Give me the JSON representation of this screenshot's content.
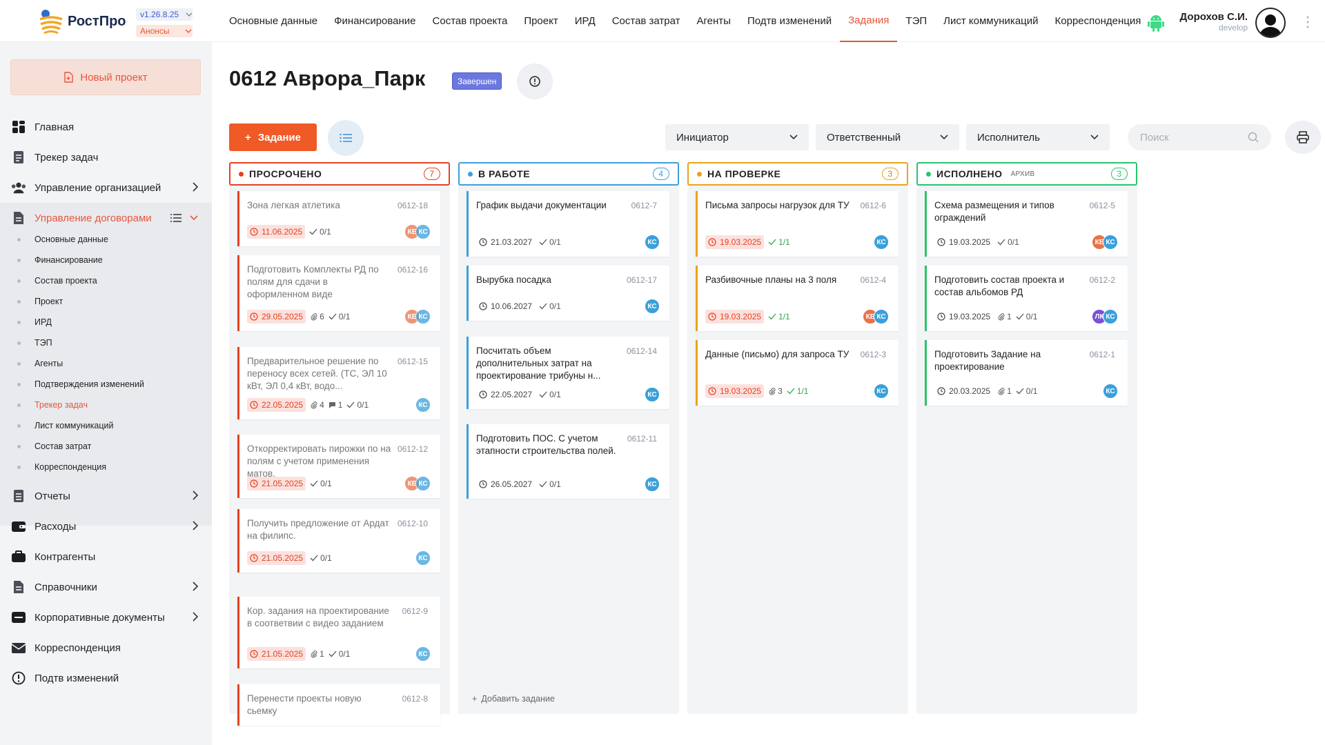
{
  "app": {
    "logo": "РостПро",
    "version": "v1.26.8.25",
    "announcements": "Анонсы"
  },
  "nav": [
    "Основные данные",
    "Финансирование",
    "Состав проекта",
    "Проект",
    "ИРД",
    "Состав затрат",
    "Агенты",
    "Подтв изменений",
    "Задания",
    "ТЭП",
    "Лист коммуникаций",
    "Корреспонденция"
  ],
  "nav_active": "Задания",
  "user": {
    "name": "Дорохов С.И.",
    "role": "develop"
  },
  "sidebar": {
    "new_project": "Новый проект",
    "items": [
      "Главная",
      "Трекер задач",
      "Управление организацией",
      "Управление договорами"
    ],
    "sub": [
      "Основные данные",
      "Финансирование",
      "Состав проекта",
      "Проект",
      "ИРД",
      "ТЭП",
      "Агенты",
      "Подтверждения изменений",
      "Трекер задач",
      "Лист коммуникаций",
      "Состав затрат",
      "Корреспонденция"
    ],
    "bottom": [
      "Отчеты",
      "Расходы",
      "Контрагенты",
      "Справочники",
      "Корпоративные документы",
      "Корреспонденция",
      "Подтв изменений"
    ]
  },
  "page": {
    "title": "0612 Аврора_Парк",
    "status": "Завершен",
    "add_task": "Задание",
    "filters": [
      "Инициатор",
      "Ответственный",
      "Исполнитель"
    ],
    "search_placeholder": "Поиск"
  },
  "colors": {
    "accent": "#e8553b",
    "overdue": "#e4411f",
    "in_work": "#3aa0dc",
    "review": "#eaa21a",
    "done": "#2ac46b"
  },
  "columns": [
    {
      "title": "ПРОСРОЧЕНО",
      "count": "7",
      "cards": [
        {
          "title": "Зона легкая атлетика",
          "code": "0612-18",
          "date": "11.06.2025",
          "checks": "0/1",
          "avatars": [
            "КЕ",
            "КС"
          ]
        },
        {
          "title": "Подготовить Комплекты РД по полям для сдачи в оформленном виде",
          "code": "0612-16",
          "date": "29.05.2025",
          "attach": "6",
          "checks": "0/1",
          "avatars": [
            "КЕ",
            "КС"
          ]
        },
        {
          "title": "Предварительное решение по переносу всех сетей. (ТС, ЭЛ 10 кВт, ЭЛ 0,4 кВт, водо...",
          "code": "0612-15",
          "date": "22.05.2025",
          "attach": "4",
          "comments": "1",
          "checks": "0/1",
          "avatars": [
            "КС"
          ]
        },
        {
          "title": "Откорректировать пирожки по на полям с учетом применения матов.",
          "code": "0612-12",
          "date": "21.05.2025",
          "checks": "0/1",
          "avatars": [
            "КЕ",
            "КС"
          ]
        },
        {
          "title": "Получить предложение от Ардат на филипс.",
          "code": "0612-10",
          "date": "21.05.2025",
          "checks": "0/1",
          "avatars": [
            "КС"
          ]
        },
        {
          "title": "Кор. задания на проектирование в соответвии с видео заданием",
          "code": "0612-9",
          "date": "21.05.2025",
          "attach": "1",
          "checks": "0/1",
          "avatars": [
            "КС"
          ]
        },
        {
          "title": "Перенести проекты новую сьемку",
          "code": "0612-8"
        }
      ]
    },
    {
      "title": "В РАБОТЕ",
      "count": "4",
      "add": "Добавить задание",
      "cards": [
        {
          "title": "График выдачи документации",
          "code": "0612-7",
          "date": "21.03.2027",
          "checks": "0/1",
          "avatars": [
            "КС"
          ]
        },
        {
          "title": "Вырубка посадка",
          "code": "0612-17",
          "date": "10.06.2027",
          "checks": "0/1",
          "avatars": [
            "КС"
          ]
        },
        {
          "title": "Посчитать объем дополнительных затрат на проектирование трибуны н...",
          "code": "0612-14",
          "date": "22.05.2027",
          "checks": "0/1",
          "avatars": [
            "КС"
          ]
        },
        {
          "title": "Подготовить ПОС. С учетом этапности строительства полей.",
          "code": "0612-11",
          "date": "26.05.2027",
          "checks": "0/1",
          "avatars": [
            "КС"
          ]
        }
      ]
    },
    {
      "title": "НА ПРОВЕРКЕ",
      "count": "3",
      "cards": [
        {
          "title": "Письма запросы нагрузок для ТУ",
          "code": "0612-6",
          "date": "19.03.2025",
          "checks": "1/1",
          "avatars": [
            "КС"
          ]
        },
        {
          "title": "Разбивочные планы на 3 поля",
          "code": "0612-4",
          "date": "19.03.2025",
          "checks": "1/1",
          "avatars": [
            "КЕ",
            "КС"
          ]
        },
        {
          "title": "Данные (письмо) для запроса ТУ",
          "code": "0612-3",
          "date": "19.03.2025",
          "attach": "3",
          "checks": "1/1",
          "avatars": [
            "КС"
          ]
        }
      ]
    },
    {
      "title": "ИСПОЛНЕНО",
      "archive": "АРХИВ",
      "count": "3",
      "cards": [
        {
          "title": "Схема размещения и типов ограждений",
          "code": "0612-5",
          "date": "19.03.2025",
          "checks": "0/1",
          "avatars": [
            "КЕ",
            "КС"
          ]
        },
        {
          "title": "Подготовить состав проекта и состав альбомов РД",
          "code": "0612-2",
          "date": "19.03.2025",
          "attach": "1",
          "checks": "0/1",
          "avatars": [
            "ЛК",
            "КС"
          ]
        },
        {
          "title": "Подготовить Задание на проектирование",
          "code": "0612-1",
          "date": "20.03.2025",
          "attach": "1",
          "checks": "0/1",
          "avatars": [
            "КС"
          ]
        }
      ]
    }
  ]
}
